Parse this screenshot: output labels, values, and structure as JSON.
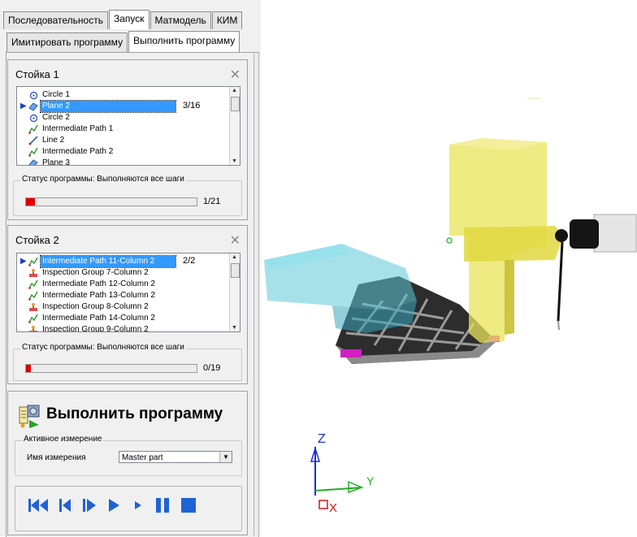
{
  "tabs": [
    "Последовательность",
    "Запуск",
    "Матмодель",
    "КИМ"
  ],
  "subtabs": [
    "Имитировать программу",
    "Выполнить программу"
  ],
  "station1": {
    "title": "Стойка 1",
    "items": [
      "Circle 1",
      "Plane 2",
      "Circle 2",
      "Intermediate Path 1",
      "Line 2",
      "Intermediate Path 2",
      "Plane 3"
    ],
    "counter": "3/16",
    "status_label": "Статус программы: Выполняются все шаги",
    "progress_value": 0.05,
    "progress_text": "1/21"
  },
  "station2": {
    "title": "Стойка 2",
    "items": [
      "Intermediate Path 11-Column 2",
      "Inspection Group 7-Column 2",
      "Intermediate Path 12-Column 2",
      "Intermediate Path 13-Column 2",
      "Inspection Group 8-Column 2",
      "Intermediate Path 14-Column 2",
      "Inspection Group 9-Column 2"
    ],
    "counter": "2/2",
    "status_label": "Статус программы: Выполняются все шаги",
    "progress_value": 0.03,
    "progress_text": "0/19"
  },
  "run": {
    "title": "Выполнить программу",
    "measure_group": "Активное измерение",
    "measure_label": "Имя измерения",
    "measure_value": "Master part",
    "controls": [
      "rewind-start-icon",
      "step-back-icon",
      "step-forward-icon",
      "play-icon",
      "slow-play-icon",
      "pause-icon",
      "stop-icon"
    ]
  },
  "axes": {
    "x": "X",
    "y": "Y",
    "z": "Z"
  },
  "colors": {
    "highlight": "#3399ff",
    "progress": "#e00000",
    "control_blue": "#1e62d6",
    "machine_yellow": "#e8e45a",
    "table_cyan": "#5cc8d8"
  }
}
